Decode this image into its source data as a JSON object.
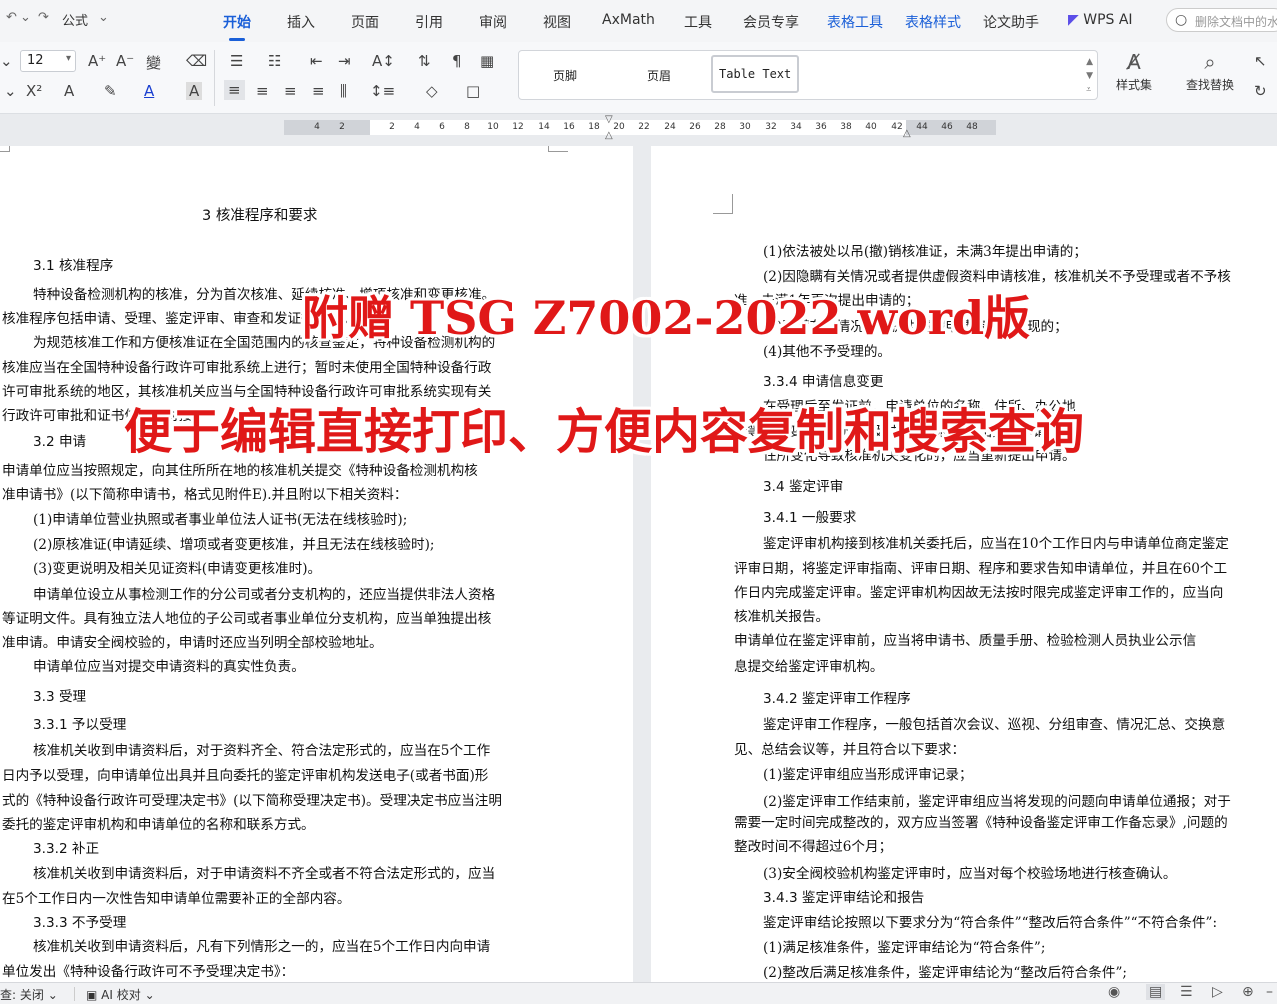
{
  "menubar": {
    "quick_access": {
      "redo_icon": "↷",
      "format_label": "公式"
    },
    "tabs": [
      {
        "label": "开始",
        "active": true
      },
      {
        "label": "插入"
      },
      {
        "label": "页面"
      },
      {
        "label": "引用"
      },
      {
        "label": "审阅"
      },
      {
        "label": "视图"
      },
      {
        "label": "AxMath"
      },
      {
        "label": "工具"
      },
      {
        "label": "会员专享"
      },
      {
        "label": "表格工具",
        "context": true
      },
      {
        "label": "表格样式",
        "context": true
      },
      {
        "label": "论文助手"
      },
      {
        "label": "WPS AI"
      }
    ],
    "search_placeholder": "删除文档中的水"
  },
  "ribbon": {
    "font_size": "12",
    "styles": [
      "页脚",
      "页眉",
      "Table Text"
    ],
    "styles_button": "样式集",
    "find_replace_button": "查找替换"
  },
  "ruler_ticks": [
    "4",
    "2",
    "2",
    "4",
    "6",
    "8",
    "10",
    "12",
    "14",
    "16",
    "18",
    "20",
    "22",
    "24",
    "26",
    "28",
    "30",
    "32",
    "34",
    "36",
    "38",
    "40",
    "42",
    "44",
    "46",
    "48"
  ],
  "left_page": {
    "lines": [
      "3  核准程序和要求",
      "3.1  核准程序",
      "特种设备检测机构的核准，分为首次核准、延续核准、增项核准和变更核准。",
      "核准程序包括申请、受理、鉴定评审、审查和发证等环节。",
      "为规范核准工作和方便核准证在全国范围内的核查鉴定，特种设备检测机构的",
      "核准应当在全国特种设备行政许可审批系统上进行；暂时未使用全国特种设备行政",
      "许可审批系统的地区，其核准机关应当与全国特种设备行政许可审批系统实现有关",
      "行政许可审批和证书信息的对接。",
      "3.2  申请",
      "申请单位应当按照规定，向其住所所在地的核准机关提交《特种设备检测机构核",
      "准申请书》(以下简称申请书，格式见附件E).并且附以下相关资料：",
      "(1)申请单位营业执照或者事业单位法人证书(无法在线核验时);",
      "(2)原核准证(申请延续、增项或者变更核准，并且无法在线核验时);",
      "(3)变更说明及相关见证资料(申请变更核准时)。",
      "申请单位设立从事检测工作的分公司或者分支机构的，还应当提供非法人资格",
      "等证明文件。具有独立法人地位的子公司或者事业单位分支机构，应当单独提出核",
      "准申请。申请安全阀校验的，申请时还应当列明全部校验地址。",
      "申请单位应当对提交申请资料的真实性负责。",
      "3.3  受理",
      "3.3.1  予以受理",
      "核准机关收到申请资料后，对于资料齐全、符合法定形式的，应当在5个工作",
      "日内予以受理，向申请单位出具并且向委托的鉴定评审机构发送电子(或者书面)形",
      "式的《特种设备行政许可受理决定书》(以下简称受理决定书)。受理决定书应当注明",
      "委托的鉴定评审机构和申请单位的名称和联系方式。",
      "3.3.2  补正",
      "核准机关收到申请资料后，对于申请资料不齐全或者不符合法定形式的，应当",
      "在5个工作日内一次性告知申请单位需要补正的全部内容。",
      "3.3.3  不予受理",
      "核准机关收到申请资料后，凡有下列情形之一的，应当在5个工作日内向申请",
      "单位发出《特种设备行政许可不予受理决定书》："
    ]
  },
  "right_page": {
    "lines": [
      "(1)依法被处以吊(撤)销核准证，未满3年提出申请的；",
      "(2)因隐瞒有关情况或者提供虚假资料申请核准，核准机关不予受理或者不予核",
      "准，未满1年再次提出申请的；",
      "(3)隐瞒有关情况或者提供虚假申请资料被发现的；",
      "(4)其他不予受理的。",
      "3.3.4  申请信息变更",
      "在受理后至发证前，申请单位的名称、住所、办公地",
      "址等发生变化的，应当及时向核准机关提出变更申请。",
      "住所变化导致核准机关变化的，应当重新提出申请。",
      "3.4  鉴定评审",
      "3.4.1  一般要求",
      "鉴定评审机构接到核准机关委托后，应当在10个工作日内与申请单位商定鉴定",
      "评审日期，将鉴定评审指南、评审日期、程序和要求告知申请单位，并且在60个工",
      "作日内完成鉴定评审。鉴定评审机构因故无法按时限完成鉴定评审工作的，应当向",
      "核准机关报告。",
      "申请单位在鉴定评审前，应当将申请书、质量手册、检验检测人员执业公示信",
      "息提交给鉴定评审机构。",
      "3.4.2  鉴定评审工作程序",
      "鉴定评审工作程序，一般包括首次会议、巡视、分组审查、情况汇总、交换意",
      "见、总结会议等，并且符合以下要求：",
      "(1)鉴定评审组应当形成评审记录；",
      "(2)鉴定评审工作结束前，鉴定评审组应当将发现的问题向申请单位通报；对于",
      "需要一定时间完成整改的，双方应当签署《特种设备鉴定评审工作备忘录》,问题的",
      "整改时间不得超过6个月；",
      "(3)安全阀校验机构鉴定评审时，应当对每个校验场地进行核查确认。",
      "3.4.3  鉴定评审结论和报告",
      "鉴定评审结论按照以下要求分为“符合条件”“整改后符合条件”“不符合条件”:",
      "(1)满足核准条件，鉴定评审结论为“符合条件”;",
      "(2)整改后满足核准条件，鉴定评审结论为“整改后符合条件”;"
    ]
  },
  "overlay": {
    "line1": "附赠 TSG Z7002-2022 word版",
    "line2": "便于编辑直接打印、方便内容复制和搜索查询"
  },
  "statusbar": {
    "proofread_label": "查: 关闭",
    "ai_check_label": "AI 校对"
  },
  "colors": {
    "accent": "#1a5fd8",
    "overlay_text": "#e01818"
  }
}
